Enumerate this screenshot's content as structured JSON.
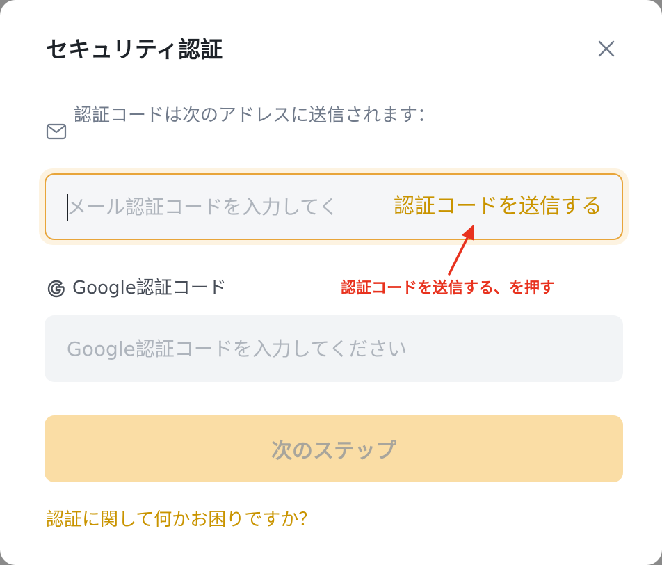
{
  "dialog": {
    "title": "セキュリティ認証",
    "close_icon": "close-icon"
  },
  "email": {
    "label": "認証コードは次のアドレスに送信されます：",
    "icon": "mail-icon",
    "placeholder": "メール認証コードを入力してく",
    "value": "",
    "send_code_label": "認証コードを送信する"
  },
  "google": {
    "label": "Google認証コード",
    "icon": "google-icon",
    "placeholder": "Google認証コードを入力してください",
    "value": ""
  },
  "annotation": {
    "text": "認証コードを送信する、を押す"
  },
  "actions": {
    "next_label": "次のステップ"
  },
  "help": {
    "link_label": "認証に関して何かお困りですか？"
  },
  "colors": {
    "accent": "#c99400",
    "focus_border": "#e8a53a",
    "button_disabled_bg": "#fadda5",
    "annotation": "#e8321e"
  }
}
